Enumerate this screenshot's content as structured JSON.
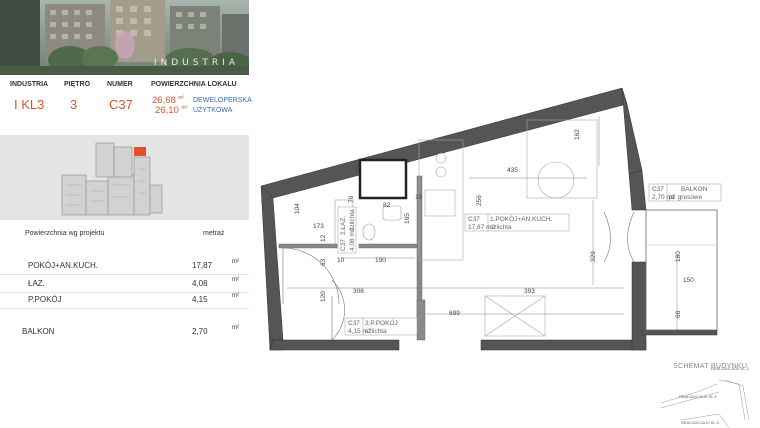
{
  "brand": {
    "name": "INDUSTRIA"
  },
  "header": {
    "col_industria": "INDUSTRIA",
    "col_pietro": "PIĘTRO",
    "col_numer": "NUMER",
    "col_powierzchnia": "POWIERZCHNIA LOKALU",
    "val_industria": "I KL3",
    "val_pietro": "3",
    "val_numer": "C37",
    "area_dev": "26,68",
    "area_dev_unit": "m²",
    "area_dev_label": "DEWELOPERSKA",
    "area_use": "26,10",
    "area_use_unit": "m²",
    "area_use_label": "UŻYTKOWA"
  },
  "areas": {
    "title": "Powierzchnia wg projektu",
    "unit_header": "metraż",
    "rows": [
      {
        "name": "POKÓJ+AN.KUCH.",
        "value": "17,87",
        "unit": "m²"
      },
      {
        "name": "ŁAZ.",
        "value": "4,08",
        "unit": "m²"
      },
      {
        "name": "P.POKÓJ",
        "value": "4,15",
        "unit": "m²"
      }
    ],
    "balcony": {
      "name": "BALKON",
      "value": "2,70",
      "unit": "m²"
    }
  },
  "plan": {
    "room_main": {
      "code": "C37",
      "name": "1.POKÓJ+AN.KUCH.",
      "area": "17,87 m2",
      "finish": "szlichta"
    },
    "room_bath": {
      "code": "C37",
      "name": "2.ŁAZ.",
      "area": "4,08 m2",
      "finish": "szlichta"
    },
    "room_hall": {
      "code": "C37",
      "name": "3.P.POKÓJ",
      "area": "4,15 m2",
      "finish": "szlichta"
    },
    "balcony": {
      "code": "C37",
      "name": "BALKON",
      "area": "2,70 m2",
      "finish": "pł. gresowe"
    },
    "dims": {
      "d162": "162",
      "d435": "435",
      "d256": "256",
      "d329": "329",
      "d393": "393",
      "d699": "699",
      "d306": "306",
      "d190": "190",
      "d165": "165",
      "d173": "173",
      "d104": "104",
      "d76": "76",
      "d82": "82",
      "d10a": "10",
      "d10b": "10",
      "d12": "12",
      "d63": "63",
      "d120": "120",
      "d180": "180",
      "d150": "150",
      "d66": "66"
    },
    "schemat": {
      "title": "SCHEMAT BUDYNKU",
      "kl1": "REALIZACJA III KL.1",
      "kl2": "REALIZACJA III KL.2",
      "kl3": "REALIZACJA III KL.3"
    }
  }
}
